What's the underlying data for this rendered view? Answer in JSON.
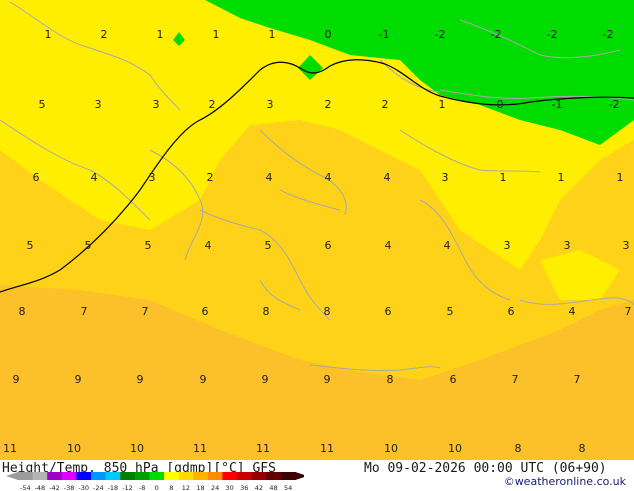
{
  "header": {
    "title": "Height/Temp. 850 hPa [gdmp][°C] GFS",
    "datetime": "Mo 09-02-2026 00:00 UTC (06+90)",
    "credit": "©weatheronline.co.uk"
  },
  "colorbar": {
    "ticks": [
      "-54",
      "-48",
      "-42",
      "-38",
      "-30",
      "-24",
      "-18",
      "-12",
      "-8",
      "0",
      "8",
      "12",
      "18",
      "24",
      "30",
      "36",
      "42",
      "48",
      "54"
    ],
    "colors": [
      "#9b9b9b",
      "#b4b4b4",
      "#a000c8",
      "#e000ff",
      "#0000ff",
      "#0096ff",
      "#00c8ff",
      "#008000",
      "#00a000",
      "#00dc00",
      "#ffff00",
      "#ffdc00",
      "#ffb400",
      "#ff8c00",
      "#ff0000",
      "#c80000",
      "#960000",
      "#640000",
      "#3c0000"
    ]
  },
  "temperature_labels": [
    {
      "t": "1",
      "row": 0
    },
    {
      "t": "2",
      "row": 0
    },
    {
      "t": "1",
      "row": 0
    },
    {
      "t": "1",
      "row": 0
    },
    {
      "t": "1",
      "row": 0
    },
    {
      "t": "0",
      "row": 0
    },
    {
      "t": "-1",
      "row": 0
    },
    {
      "t": "-2",
      "row": 0
    },
    {
      "t": "-2",
      "row": 0
    },
    {
      "t": "-2",
      "row": 0
    },
    {
      "t": "-2",
      "row": 0
    },
    {
      "t": "5",
      "row": 1
    },
    {
      "t": "3",
      "row": 1
    },
    {
      "t": "3",
      "row": 1
    },
    {
      "t": "2",
      "row": 1
    },
    {
      "t": "3",
      "row": 1
    },
    {
      "t": "2",
      "row": 1
    },
    {
      "t": "2",
      "row": 1
    },
    {
      "t": "1",
      "row": 1
    },
    {
      "t": "0",
      "row": 1
    },
    {
      "t": "-1",
      "row": 1
    },
    {
      "t": "-2",
      "row": 1
    },
    {
      "t": "6",
      "row": 2
    },
    {
      "t": "4",
      "row": 2
    },
    {
      "t": "3",
      "row": 2
    },
    {
      "t": "2",
      "row": 2
    },
    {
      "t": "4",
      "row": 2
    },
    {
      "t": "4",
      "row": 2
    },
    {
      "t": "4",
      "row": 2
    },
    {
      "t": "3",
      "row": 2
    },
    {
      "t": "1",
      "row": 2
    },
    {
      "t": "1",
      "row": 2
    },
    {
      "t": "1",
      "row": 2
    },
    {
      "t": "5",
      "row": 3
    },
    {
      "t": "5",
      "row": 3
    },
    {
      "t": "5",
      "row": 3
    },
    {
      "t": "4",
      "row": 3
    },
    {
      "t": "5",
      "row": 3
    },
    {
      "t": "6",
      "row": 3
    },
    {
      "t": "4",
      "row": 3
    },
    {
      "t": "4",
      "row": 3
    },
    {
      "t": "3",
      "row": 3
    },
    {
      "t": "3",
      "row": 3
    },
    {
      "t": "3",
      "row": 3
    },
    {
      "t": "8",
      "row": 4
    },
    {
      "t": "7",
      "row": 4
    },
    {
      "t": "7",
      "row": 4
    },
    {
      "t": "6",
      "row": 4
    },
    {
      "t": "8",
      "row": 4
    },
    {
      "t": "8",
      "row": 4
    },
    {
      "t": "6",
      "row": 4
    },
    {
      "t": "5",
      "row": 4
    },
    {
      "t": "6",
      "row": 4
    },
    {
      "t": "4",
      "row": 4
    },
    {
      "t": "7",
      "row": 4
    },
    {
      "t": "9",
      "row": 5
    },
    {
      "t": "9",
      "row": 5
    },
    {
      "t": "9",
      "row": 5
    },
    {
      "t": "9",
      "row": 5
    },
    {
      "t": "9",
      "row": 5
    },
    {
      "t": "9",
      "row": 5
    },
    {
      "t": "8",
      "row": 5
    },
    {
      "t": "6",
      "row": 5
    },
    {
      "t": "7",
      "row": 5
    },
    {
      "t": "7",
      "row": 5
    },
    {
      "t": "11",
      "row": 6
    },
    {
      "t": "10",
      "row": 6
    },
    {
      "t": "10",
      "row": 6
    },
    {
      "t": "11",
      "row": 6
    },
    {
      "t": "11",
      "row": 6
    },
    {
      "t": "11",
      "row": 6
    },
    {
      "t": "10",
      "row": 6
    },
    {
      "t": "10",
      "row": 6
    },
    {
      "t": "8",
      "row": 6
    },
    {
      "t": "8",
      "row": 6
    }
  ]
}
